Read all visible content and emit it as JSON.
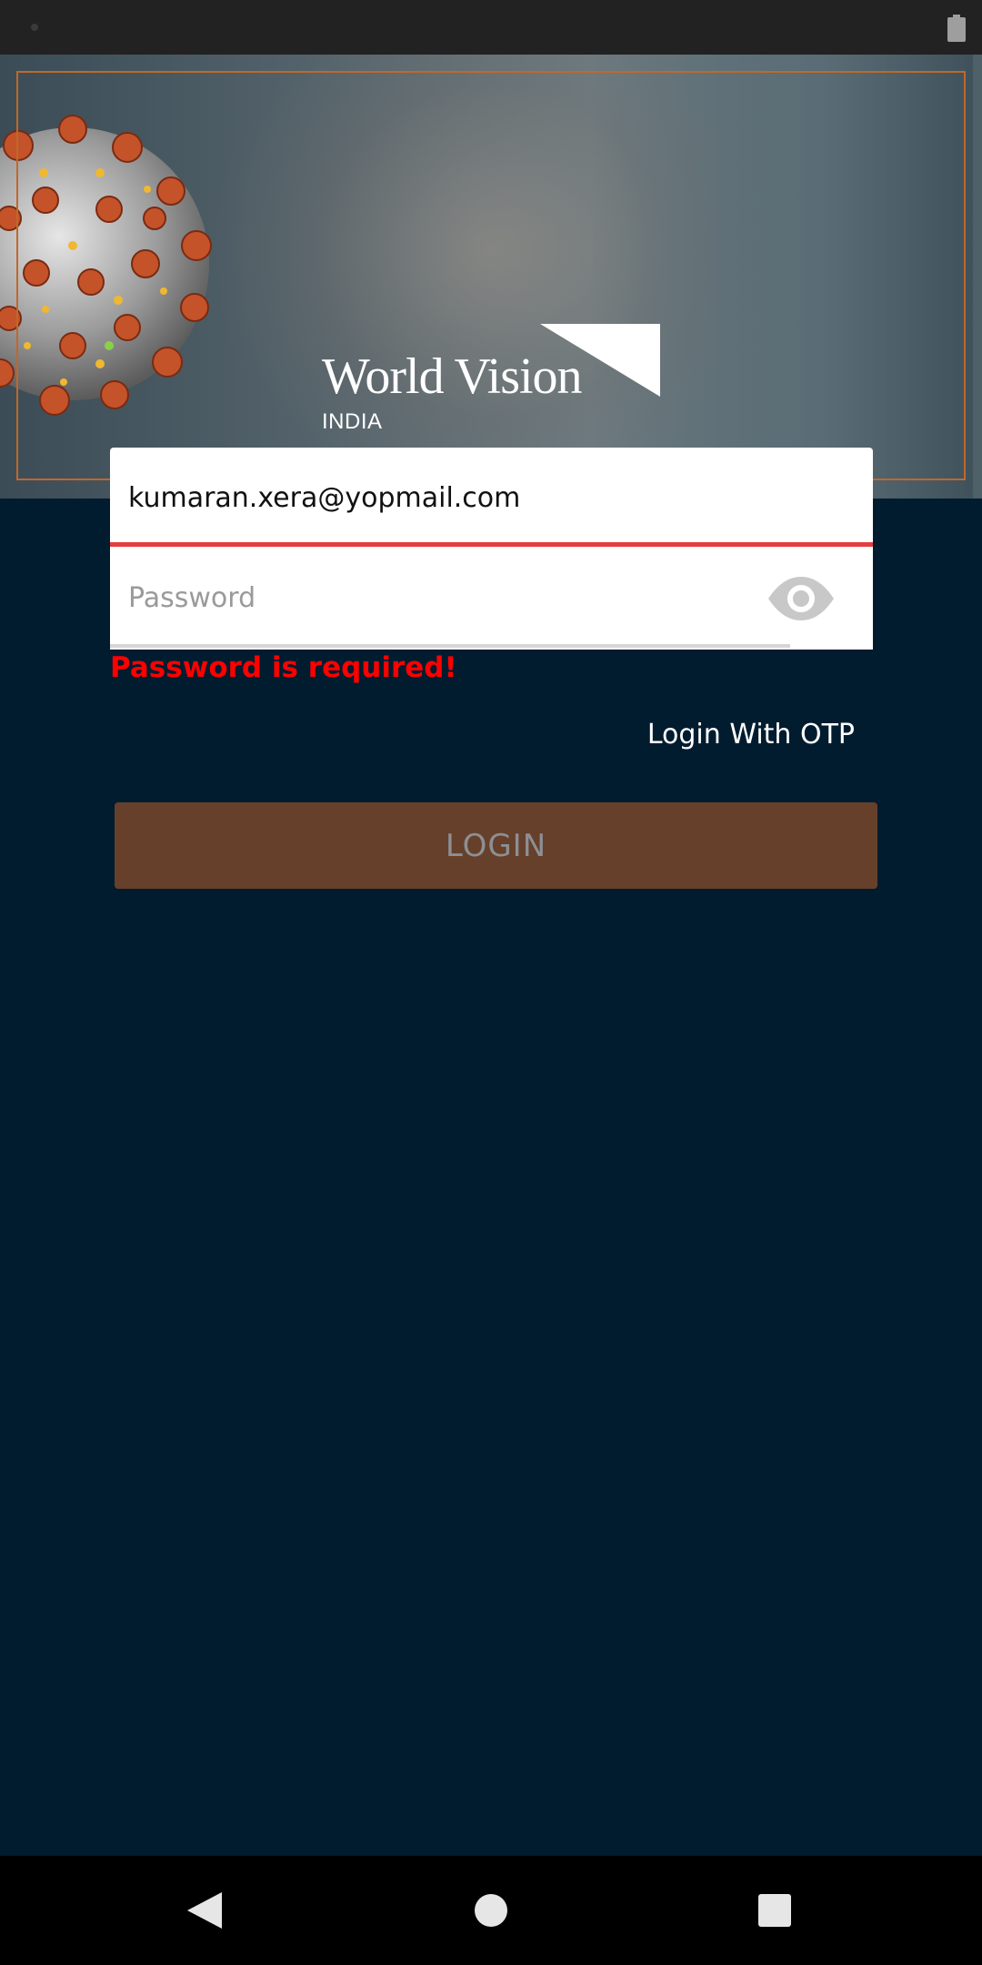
{
  "brand": {
    "title": "World Vision",
    "subtitle": "INDIA"
  },
  "form": {
    "email_value": "kumaran.xera@yopmail.com",
    "password_placeholder": "Password",
    "password_error": "Password is required!",
    "otp_link": "Login With OTP",
    "login_label": "LOGIN"
  },
  "colors": {
    "background": "#021c2f",
    "accent_frame": "#c0682a",
    "error": "#ff0000",
    "login_button": "#66402a",
    "field_error_underline": "#e53e3e"
  },
  "icons": {
    "password_toggle": "eye-icon",
    "nav_back": "back-triangle-icon",
    "nav_home": "home-circle-icon",
    "nav_recents": "recents-square-icon",
    "battery": "battery-icon"
  }
}
